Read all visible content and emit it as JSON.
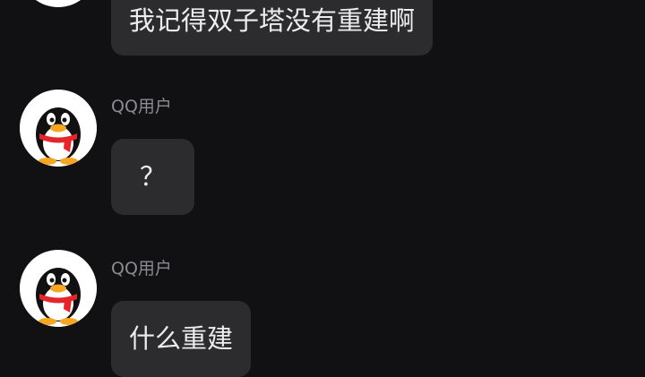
{
  "colors": {
    "background": "#111113",
    "bubble": "#2c2c2e",
    "sender_text": "#8b8b90",
    "message_text": "#ededed",
    "scarf": "#e3262b",
    "beak": "#f5a623"
  },
  "messages": [
    {
      "sender": "",
      "avatar_icon": "qq-penguin-icon",
      "text": "我记得双子塔没有重建啊"
    },
    {
      "sender": "QQ用户",
      "avatar_icon": "qq-penguin-icon",
      "text": "？"
    },
    {
      "sender": "QQ用户",
      "avatar_icon": "qq-penguin-icon",
      "text": "什么重建"
    }
  ]
}
